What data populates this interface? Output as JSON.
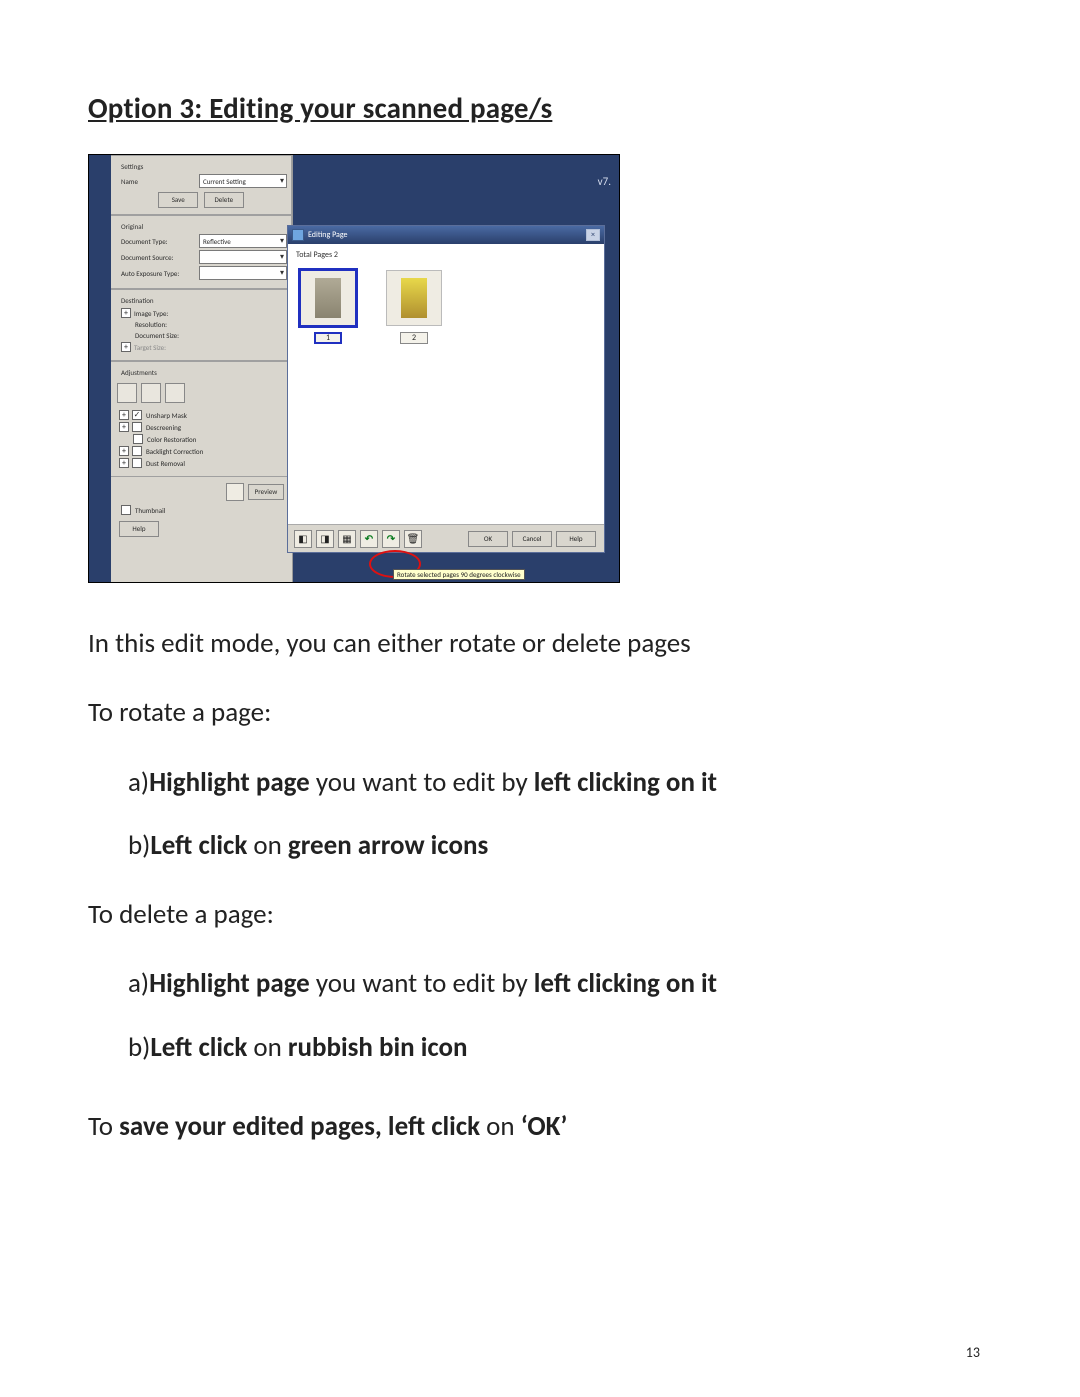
{
  "heading": "Option 3: Editing your scanned page/s",
  "screenshot": {
    "version": "v7.",
    "panel": {
      "settings": {
        "label": "Settings",
        "name_label": "Name",
        "name_value": "Current Setting",
        "save_btn": "Save",
        "delete_btn": "Delete"
      },
      "original": {
        "label": "Original",
        "doc_type_label": "Document Type:",
        "doc_type_value": "Reflective",
        "doc_source_label": "Document Source:",
        "auto_exposure_label": "Auto Exposure Type:"
      },
      "destination": {
        "label": "Destination",
        "image_type_label": "Image Type:",
        "resolution_label": "Resolution:",
        "doc_size_label": "Document Size:",
        "target_size_label": "Target Size:"
      },
      "adjustments": {
        "label": "Adjustments",
        "unsharp": "Unsharp Mask",
        "descreening": "Descreening",
        "color_restoration": "Color Restoration",
        "backlight": "Backlight Correction",
        "dust": "Dust Removal"
      },
      "preview_btn": "Preview",
      "thumbnail_chk": "Thumbnail",
      "help_btn": "Help"
    },
    "dialog": {
      "title": "Editing Page",
      "total_label": "Total Pages 2",
      "thumb1_num": "1",
      "thumb2_num": "2",
      "ok_btn": "OK",
      "cancel_btn": "Cancel",
      "help_btn": "Help",
      "tooltip": "Rotate selected pages 90 degrees clockwise"
    }
  },
  "text": {
    "intro": "In this edit mode, you can either rotate or delete pages",
    "rotate_intro": "To rotate a page:",
    "rotate_a_pre": "a)",
    "rotate_a_b1": "Highlight page",
    "rotate_a_mid": " you want to edit by ",
    "rotate_a_b2": "left clicking on it",
    "rotate_b_pre": "b)",
    "rotate_b_b1": "Left click",
    "rotate_b_mid": " on ",
    "rotate_b_b2": "green arrow icons",
    "delete_intro": "To delete a page:",
    "delete_a_pre": "a)",
    "delete_a_b1": "Highlight page",
    "delete_a_mid": " you want to edit by ",
    "delete_a_b2": "left clicking on it",
    "delete_b_pre": "b)",
    "delete_b_b1": "Left click",
    "delete_b_mid": " on ",
    "delete_b_b2": "rubbish bin icon",
    "save_pre": "To ",
    "save_b1": "save your edited pages, left click",
    "save_mid": " on ",
    "save_b2": "‘OK’"
  },
  "page_number": "13"
}
